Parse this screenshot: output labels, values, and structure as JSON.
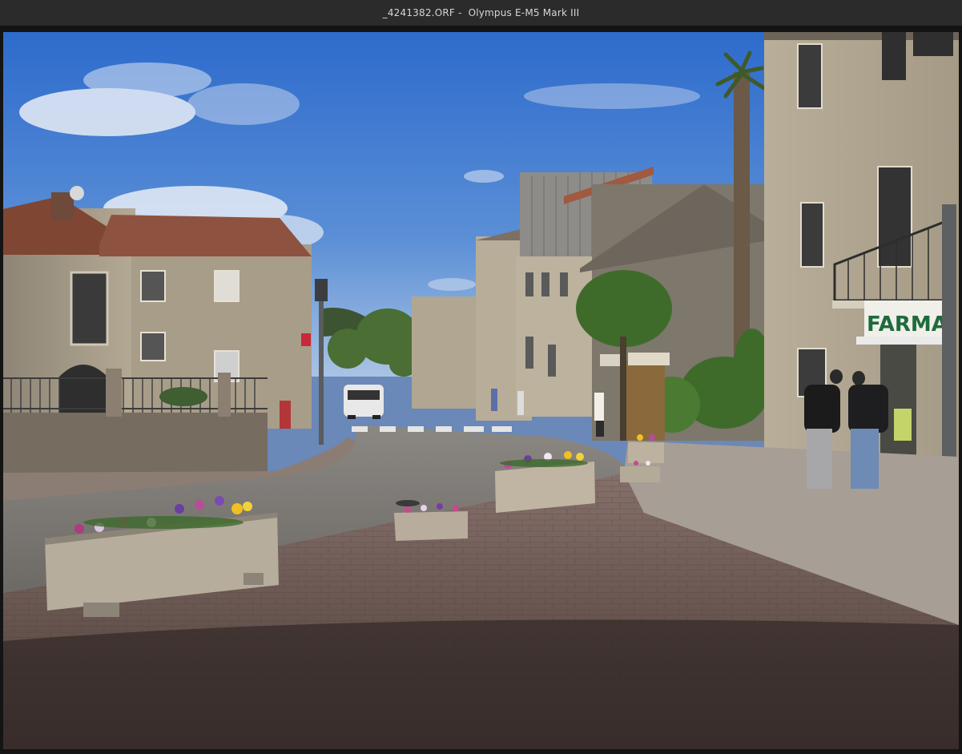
{
  "window": {
    "file_name": "_4241382.ORF",
    "separator": " -  ",
    "camera": "Olympus E-M5 Mark III"
  },
  "photo": {
    "shop_sign": "FARMA",
    "colors": {
      "sky_top": "#2f6fcf",
      "sky_bottom": "#8fb0dc",
      "stone": "#a79c8a",
      "roof": "#8a4a35",
      "pavement": "#6e5a52",
      "road": "#7d7a76",
      "foliage": "#3f6b2a"
    }
  }
}
